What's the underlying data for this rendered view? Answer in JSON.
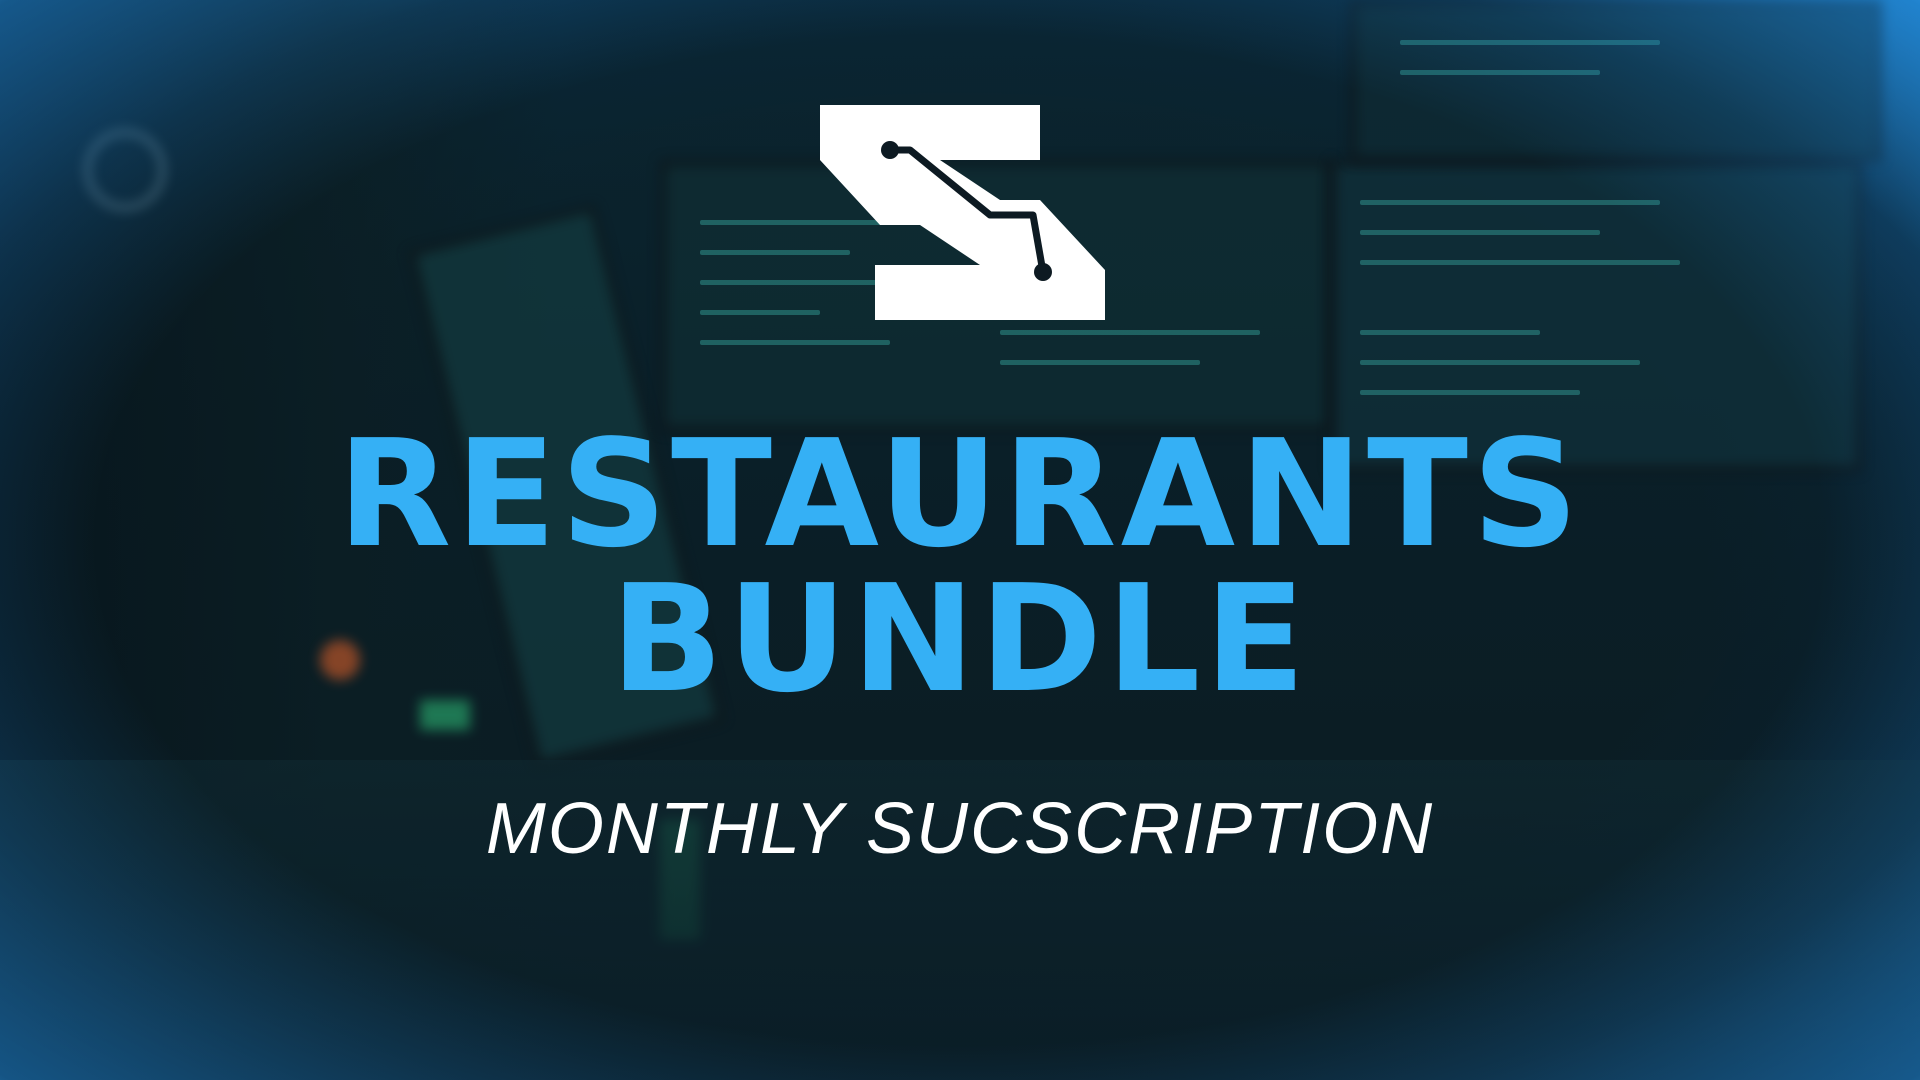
{
  "hero": {
    "title_line1": "RESTAURANTS",
    "title_line2": "BUNDLE",
    "subtitle": "MONTHLY SUCSCRIPTION"
  },
  "logo": {
    "icon": "s-circuit-logo-icon",
    "color": "#ffffff"
  },
  "colors": {
    "title": "#35b0f5",
    "subtitle": "#ffffff",
    "edge_glow": "#3ca9f0",
    "background": "#0b2530"
  }
}
